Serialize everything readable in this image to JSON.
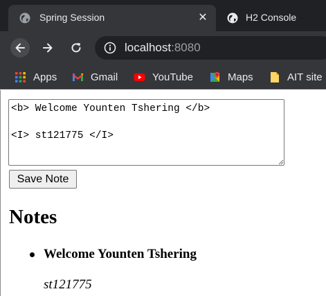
{
  "tabs": [
    {
      "title": "Spring Session",
      "icon": "globe-icon",
      "active": true
    },
    {
      "title": "H2 Console",
      "icon": "globe-icon",
      "active": false
    }
  ],
  "address_bar": {
    "host": "localhost",
    "port": ":8080"
  },
  "bookmarks": [
    {
      "label": "Apps",
      "icon": "apps-grid-icon"
    },
    {
      "label": "Gmail",
      "icon": "gmail-icon"
    },
    {
      "label": "YouTube",
      "icon": "youtube-icon"
    },
    {
      "label": "Maps",
      "icon": "maps-icon"
    },
    {
      "label": "AIT site",
      "icon": "bookmark-folder-icon"
    }
  ],
  "form": {
    "textarea_value": "<b> Welcome Younten Tshering </b>\n\n<I> st121775 </I>",
    "save_button": "Save Note"
  },
  "notes": {
    "heading": "Notes",
    "items": [
      {
        "title": "Welcome Younten Tshering",
        "subtitle": "st121775"
      }
    ]
  },
  "colors": {
    "tab_strip": "#202124",
    "toolbar": "#35363a",
    "text_light": "#e8eaed",
    "text_dim": "#9aa0a6"
  }
}
